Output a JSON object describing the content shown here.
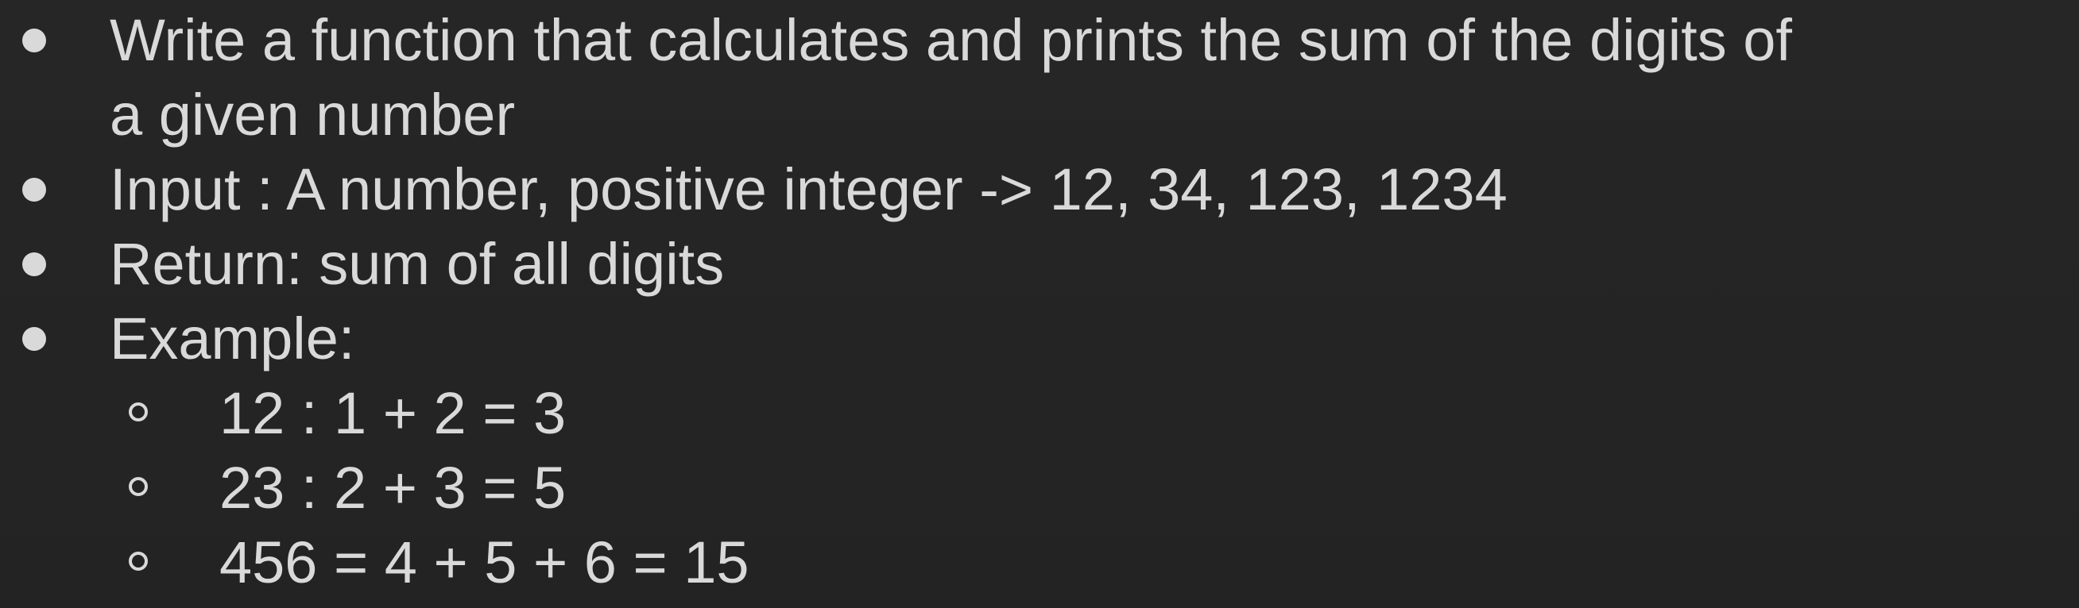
{
  "slide": {
    "bullets": [
      {
        "lines": [
          "Write a function that calculates and prints the sum of the digits of",
          "a given number"
        ]
      },
      {
        "text": "Input : A number, positive integer -> 12, 34, 123, 1234"
      },
      {
        "text": "Return: sum of all digits"
      },
      {
        "text": "Example:"
      }
    ],
    "examples": [
      "12 : 1 + 2 = 3",
      "23 : 2 + 3 = 5",
      "456 = 4 + 5 + 6 = 15"
    ],
    "colors": {
      "background": "#252525",
      "text": "#d9d9d9"
    }
  }
}
